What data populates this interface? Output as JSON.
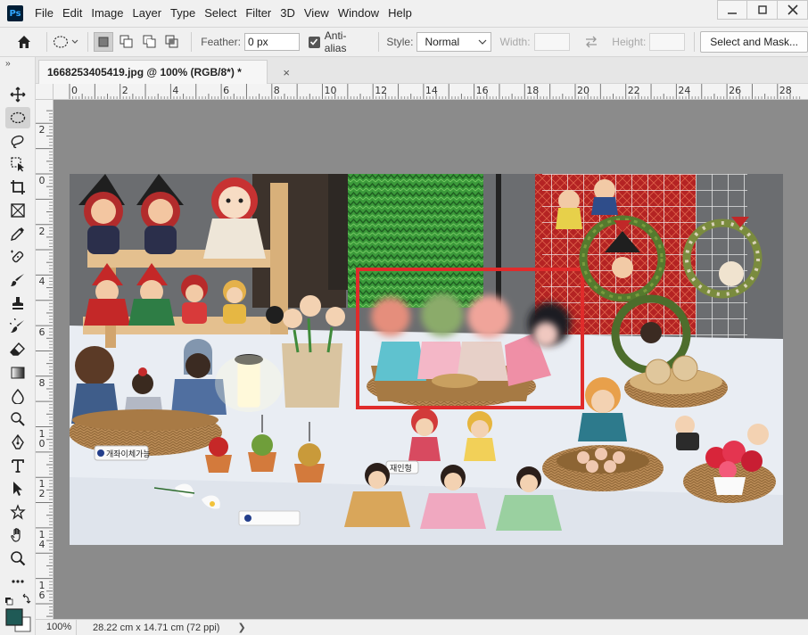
{
  "app": {
    "logo_text": "Ps"
  },
  "menu": [
    "File",
    "Edit",
    "Image",
    "Layer",
    "Type",
    "Select",
    "Filter",
    "3D",
    "View",
    "Window",
    "Help"
  ],
  "window_controls": {
    "minimize": "—",
    "restore": "❐",
    "close": "✕"
  },
  "options": {
    "feather_label": "Feather:",
    "feather_value": "0 px",
    "antialias_label": "Anti-alias",
    "antialias_checked": true,
    "style_label": "Style:",
    "style_value": "Normal",
    "width_label": "Width:",
    "height_label": "Height:",
    "select_mask_label": "Select and Mask..."
  },
  "document": {
    "tab_title": "1668253405419.jpg @ 100% (RGB/8*) *",
    "close": "×"
  },
  "ruler_h": [
    "0",
    "2",
    "4",
    "6",
    "8",
    "10",
    "12",
    "14",
    "16",
    "18",
    "20",
    "22",
    "24",
    "26",
    "28"
  ],
  "ruler_v": [
    [
      "2"
    ],
    [
      "0"
    ],
    [
      "2"
    ],
    [
      "4"
    ],
    [
      "6"
    ],
    [
      "8"
    ],
    [
      "1",
      "0"
    ],
    [
      "1",
      "2"
    ],
    [
      "1",
      "4"
    ],
    [
      "1",
      "6"
    ]
  ],
  "colors": {
    "foreground": "#1f5a56",
    "background": "#ffffff",
    "selection_rect": "#e02b2b",
    "pasteboard": "#8b8b8b"
  },
  "photo": {
    "sign_text": "개좌이체가능",
    "sign2_text": "재인형"
  },
  "status": {
    "zoom": "100%",
    "doc_size": "28.22 cm x 14.71 cm (72 ppi)",
    "arrow": "❯"
  }
}
